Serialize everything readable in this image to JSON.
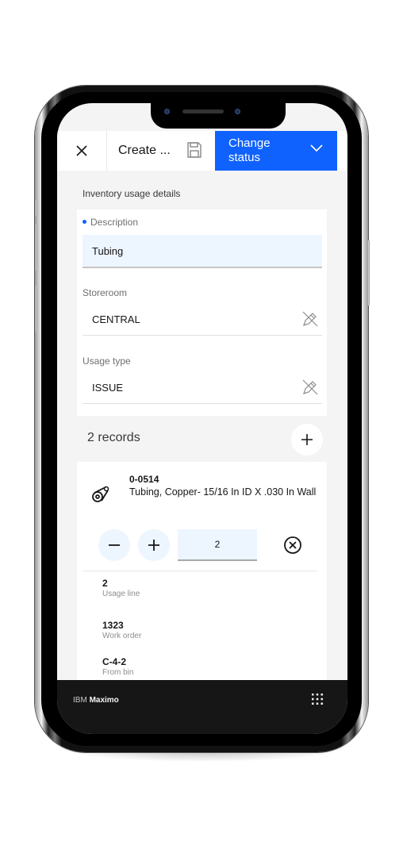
{
  "header": {
    "close_label": "close",
    "title": "Create ...",
    "status_button": "Change status"
  },
  "section": {
    "title": "Inventory usage details"
  },
  "fields": {
    "description": {
      "label": "Description",
      "value": "Tubing",
      "required": true
    },
    "storeroom": {
      "label": "Storeroom",
      "value": "CENTRAL"
    },
    "usage_type": {
      "label": "Usage type",
      "value": "ISSUE"
    }
  },
  "records": {
    "count_label": "2 records"
  },
  "item": {
    "id": "0-0514",
    "description": "Tubing, Copper- 15/16 In ID X .030 In Wall",
    "quantity": "2",
    "details": [
      {
        "value": "2",
        "label": "Usage line"
      },
      {
        "value": "1323",
        "label": "Work order"
      },
      {
        "value": "C-4-2",
        "label": "From bin"
      }
    ]
  },
  "footer": {
    "brand_prefix": "IBM",
    "brand_name": "Maximo"
  },
  "colors": {
    "accent": "#0f62fe",
    "field_bg": "#edf5ff",
    "page_bg": "#f4f4f4",
    "footer_bg": "#161616"
  }
}
